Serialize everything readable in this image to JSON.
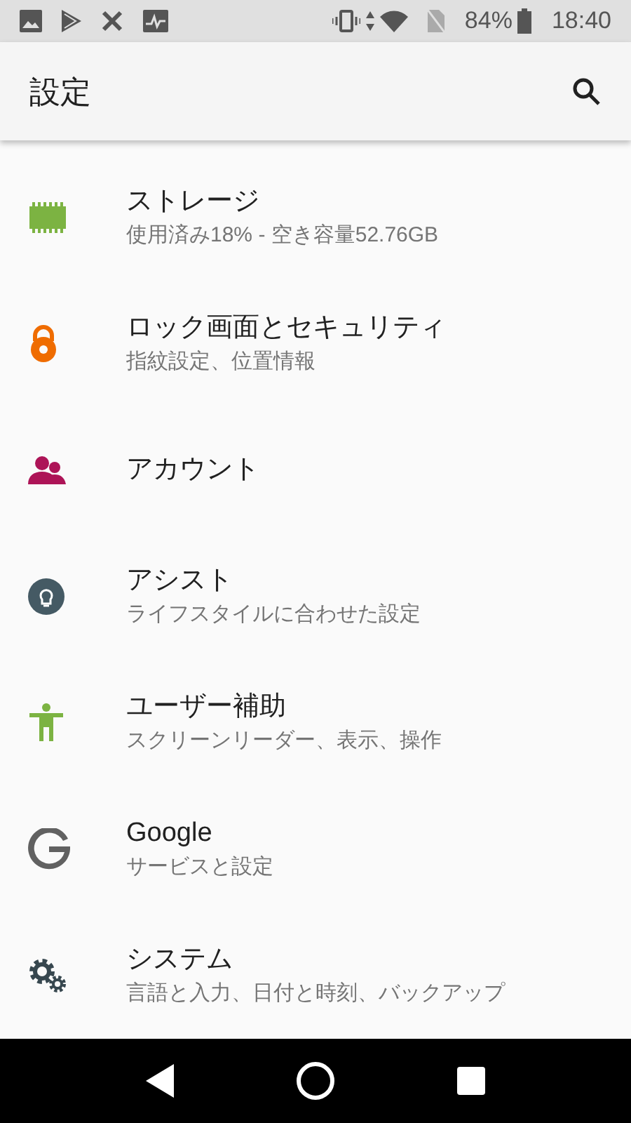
{
  "status_bar": {
    "battery": "84%",
    "time": "18:40"
  },
  "app_bar": {
    "title": "設定"
  },
  "items": [
    {
      "kind": "storage",
      "title": "ストレージ",
      "subtitle": "使用済み18% - 空き容量52.76GB"
    },
    {
      "kind": "lock",
      "title": "ロック画面とセキュリティ",
      "subtitle": "指紋設定、位置情報"
    },
    {
      "kind": "accounts",
      "title": "アカウント"
    },
    {
      "kind": "assist",
      "title": "アシスト",
      "subtitle": "ライフスタイルに合わせた設定"
    },
    {
      "kind": "accessibility",
      "title": "ユーザー補助",
      "subtitle": "スクリーンリーダー、表示、操作"
    },
    {
      "kind": "google",
      "title": "Google",
      "subtitle": "サービスと設定"
    },
    {
      "kind": "system",
      "title": "システム",
      "subtitle": "言語と入力、日付と時刻、バックアップ"
    }
  ]
}
